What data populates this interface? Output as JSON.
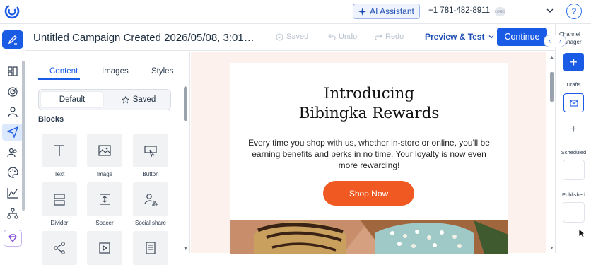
{
  "topbar": {
    "ai_assistant_label": "AI Assistant",
    "phone": "+1 781-482-8911",
    "account_badge": "LOGO"
  },
  "toolbar": {
    "campaign_title": "Untitled Campaign Created 2026/05/08, 3:01…",
    "saved_label": "Saved",
    "undo_label": "Undo",
    "redo_label": "Redo",
    "preview_label": "Preview & Test",
    "continue_label": "Continue"
  },
  "panel": {
    "tabs": [
      "Content",
      "Images",
      "Styles"
    ],
    "active_tab": "Content",
    "segment": {
      "default_label": "Default",
      "saved_label": "Saved"
    },
    "blocks_heading": "Blocks",
    "blocks": [
      {
        "label": "Text",
        "icon": "text-icon"
      },
      {
        "label": "Image",
        "icon": "image-icon"
      },
      {
        "label": "Button",
        "icon": "button-icon"
      },
      {
        "label": "Divider",
        "icon": "divider-icon"
      },
      {
        "label": "Spacer",
        "icon": "spacer-icon"
      },
      {
        "label": "Social share",
        "icon": "social-share-icon"
      },
      {
        "label": "",
        "icon": "share-icon"
      },
      {
        "label": "",
        "icon": "video-icon"
      },
      {
        "label": "",
        "icon": "document-icon"
      }
    ]
  },
  "email": {
    "headline_line1": "Introducing",
    "headline_line2": "Bibingka Rewards",
    "body": "Every time you shop with us, whether in-store or online, you'll be earning benefits and perks in no time. Your loyalty is now even more rewarding!",
    "cta_label": "Shop Now",
    "cta_color": "#f05a22"
  },
  "right_panel": {
    "title": "Channel Manager",
    "drafts_label": "Drafts",
    "scheduled_label": "Scheduled",
    "published_label": "Published"
  },
  "colors": {
    "accent": "#1a5be6",
    "canvas_bg": "#fdf1ee"
  }
}
